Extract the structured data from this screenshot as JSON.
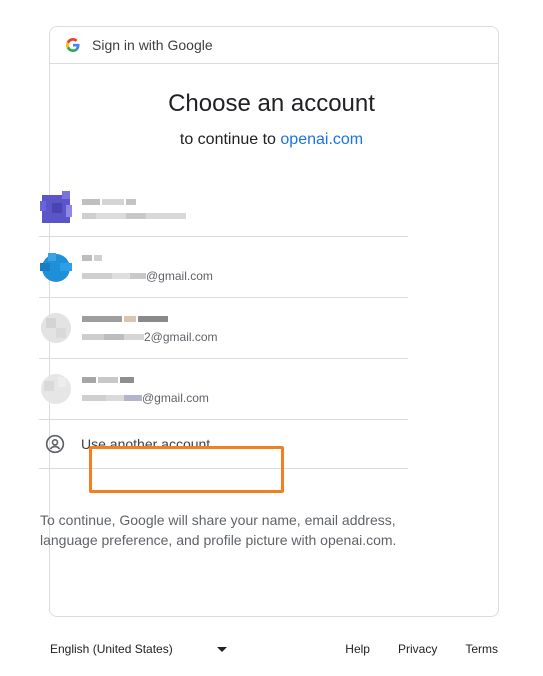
{
  "header": {
    "title": "Sign in with Google"
  },
  "main": {
    "title": "Choose an account",
    "subtitle_prefix": "to continue to ",
    "subtitle_link": "openai.com"
  },
  "accounts": [
    {
      "email_suffix": ""
    },
    {
      "email_suffix": "@gmail.com"
    },
    {
      "email_suffix": "2@gmail.com"
    },
    {
      "email_suffix": "@gmail.com"
    }
  ],
  "other_account": {
    "label": "Use another account"
  },
  "disclaimer": "To continue, Google will share your name, email address, language preference, and profile picture with openai.com.",
  "footer": {
    "language": "English (United States)",
    "help": "Help",
    "privacy": "Privacy",
    "terms": "Terms"
  },
  "colors": {
    "link": "#1a73e8",
    "highlight": "#f28021",
    "border": "#dadce0"
  },
  "icons": [
    "google-g-icon",
    "account-circle-icon",
    "dropdown-caret-icon"
  ]
}
